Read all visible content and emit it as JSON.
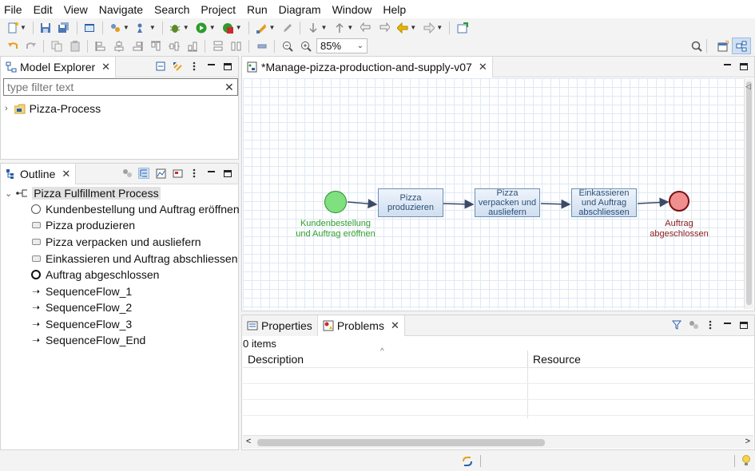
{
  "menu": [
    "File",
    "Edit",
    "View",
    "Navigate",
    "Search",
    "Project",
    "Run",
    "Diagram",
    "Window",
    "Help"
  ],
  "toolbar": {
    "zoom_value": "85%",
    "icons_row1": [
      "new-icon",
      "save-icon",
      "save-all-icon",
      "terminal-icon",
      "open-type-icon",
      "run-on-server-icon",
      "debug-icon",
      "run-icon",
      "external-tools-icon",
      "publish-icon",
      "next-annotation-icon",
      "previous-annotation-icon",
      "last-edit-icon",
      "back-icon",
      "forward-icon",
      "pin-editor-icon"
    ],
    "icons_row2": [
      "undo-icon",
      "redo-icon",
      "copy-icon",
      "paste-icon",
      "align-left-icon",
      "align-center-icon",
      "align-right-icon",
      "align-top-icon",
      "align-middle-icon",
      "align-bottom-icon",
      "match-width-icon",
      "match-height-icon",
      "delete-icon",
      "zoom-out-icon",
      "zoom-in-icon",
      "search-icon",
      "open-perspective-icon",
      "modeling-perspective-icon"
    ],
    "colors": {
      "green": "#2c9c2c",
      "orange": "#e69a1f",
      "red": "#cc2b2b",
      "blue": "#2a5fa8"
    }
  },
  "model_explorer": {
    "title": "Model Explorer",
    "filter_placeholder": "type filter text",
    "items": [
      {
        "label": "Pizza-Process"
      }
    ]
  },
  "outline": {
    "title": "Outline",
    "root": "Pizza Fulfillment Process",
    "items": [
      {
        "label": "Kundenbestellung und Auftrag eröffnen",
        "icon": "start-event-icon"
      },
      {
        "label": "Pizza produzieren",
        "icon": "task-icon"
      },
      {
        "label": "Pizza verpacken und ausliefern",
        "icon": "task-icon"
      },
      {
        "label": "Einkassieren und Auftrag abschliessen",
        "icon": "task-icon"
      },
      {
        "label": "Auftrag abgeschlossen",
        "icon": "end-event-icon"
      },
      {
        "label": "SequenceFlow_1",
        "icon": "sequence-flow-icon"
      },
      {
        "label": "SequenceFlow_2",
        "icon": "sequence-flow-icon"
      },
      {
        "label": "SequenceFlow_3",
        "icon": "sequence-flow-icon"
      },
      {
        "label": "SequenceFlow_End",
        "icon": "sequence-flow-icon"
      }
    ]
  },
  "editor": {
    "tab_title": "*Manage-pizza-production-and-supply-v07",
    "start_event": {
      "label": "Kundenbestellung und Auftrag eröffnen",
      "color": "#7ee07e",
      "text_color": "#2f9e2f"
    },
    "tasks": [
      {
        "label": "Pizza produzieren"
      },
      {
        "label": "Pizza verpacken und ausliefern"
      },
      {
        "label": "Einkassieren und Auftrag abschliessen"
      }
    ],
    "end_event": {
      "label": "Auftrag abgeschlossen",
      "color": "#f08f8f",
      "text_color": "#8b1a1a"
    }
  },
  "bottom_panel": {
    "tabs": [
      "Properties",
      "Problems"
    ],
    "items_count": "0 items",
    "columns": [
      "Description",
      "Resource"
    ]
  }
}
